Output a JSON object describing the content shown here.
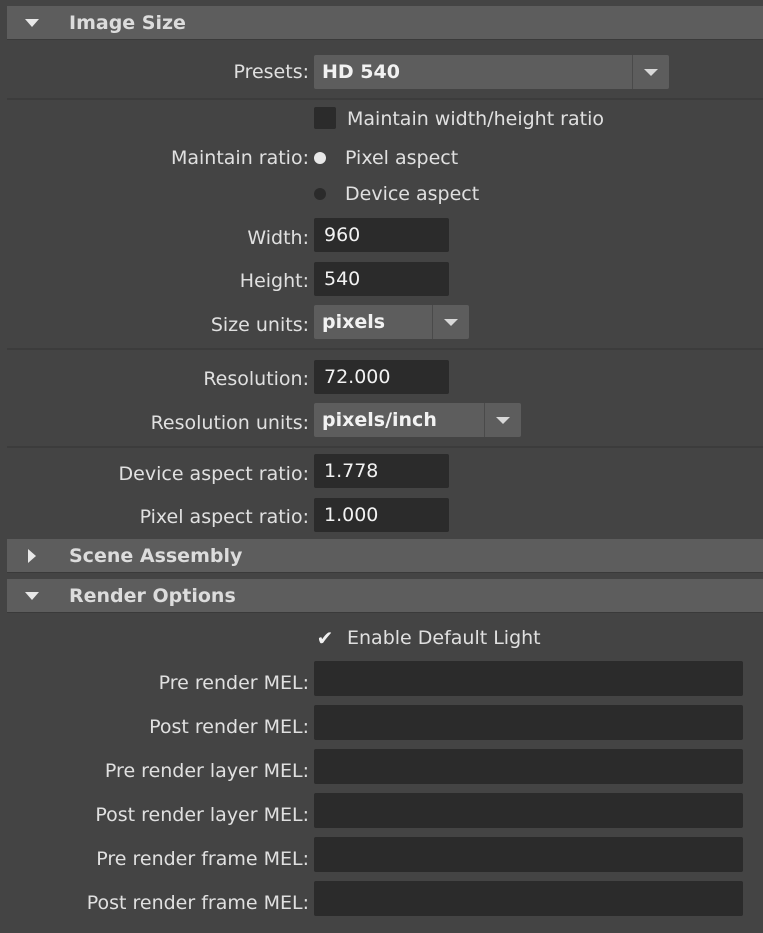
{
  "image_size": {
    "title": "Image Size",
    "presets": {
      "label": "Presets:",
      "value": "HD 540"
    },
    "maintain_wh_label": "Maintain width/height ratio",
    "maintain_ratio": {
      "label": "Maintain ratio:",
      "options": [
        "Pixel aspect",
        "Device aspect"
      ],
      "selected": "Pixel aspect"
    },
    "width": {
      "label": "Width:",
      "value": "960"
    },
    "height": {
      "label": "Height:",
      "value": "540"
    },
    "size_units": {
      "label": "Size units:",
      "value": "pixels"
    },
    "resolution": {
      "label": "Resolution:",
      "value": "72.000"
    },
    "resolution_units": {
      "label": "Resolution units:",
      "value": "pixels/inch"
    },
    "device_aspect_ratio": {
      "label": "Device aspect ratio:",
      "value": "1.778"
    },
    "pixel_aspect_ratio": {
      "label": "Pixel aspect ratio:",
      "value": "1.000"
    }
  },
  "scene_assembly": {
    "title": "Scene Assembly"
  },
  "render_options": {
    "title": "Render Options",
    "enable_default_light": {
      "label": "Enable Default Light",
      "checked": true
    },
    "mel_fields": [
      {
        "label": "Pre render MEL:",
        "value": ""
      },
      {
        "label": "Post render MEL:",
        "value": ""
      },
      {
        "label": "Pre render layer MEL:",
        "value": ""
      },
      {
        "label": "Post render layer MEL:",
        "value": ""
      },
      {
        "label": "Pre render frame MEL:",
        "value": ""
      },
      {
        "label": "Post render frame MEL:",
        "value": ""
      }
    ]
  }
}
